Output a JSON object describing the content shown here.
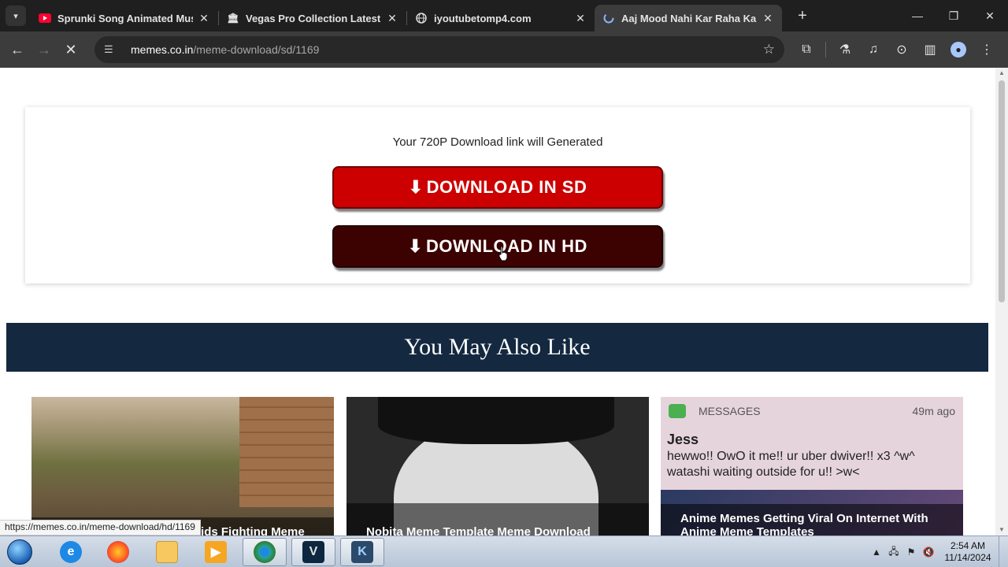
{
  "browser": {
    "tabs": [
      {
        "title": "Sprunki Song Animated Music",
        "favicon": "youtube-icon",
        "active": false
      },
      {
        "title": "Vegas Pro Collection Latest Bui",
        "favicon": "library-icon",
        "active": false
      },
      {
        "title": "iyoutubetomp4.com",
        "favicon": "globe-icon",
        "active": false
      },
      {
        "title": "Aaj Mood Nahi Kar Raha Kal D",
        "favicon": "loading-icon",
        "active": true
      }
    ],
    "url_host": "memes.co.in",
    "url_path": "/meme-download/sd/1169",
    "status_url": "https://memes.co.in/meme-download/hd/1169"
  },
  "page": {
    "info_text": "Your 720P Download link will Generated",
    "sd_button": "DOWNLOAD IN SD",
    "hd_button": "DOWNLOAD IN HD",
    "section_title": "You May Also Like",
    "related": [
      {
        "caption": "Gaddari Karta Hai Indian Kids Fighting Meme"
      },
      {
        "caption": "Nobita Meme Template Meme Download"
      },
      {
        "caption": "Anime Memes Getting Viral On Internet With Anime Meme Templates"
      }
    ],
    "messages_preview": {
      "app": "MESSAGES",
      "time": "49m ago",
      "sender": "Jess",
      "body": "hewwo!! OwO it me!! ur uber dwiver!! x3 ^w^ watashi waiting outside for u!! >w<"
    }
  },
  "taskbar": {
    "time": "2:54 AM",
    "date": "11/14/2024"
  },
  "colors": {
    "sd_button": "#cc0000",
    "hd_button": "#3c0202",
    "section_bar": "#142840"
  }
}
